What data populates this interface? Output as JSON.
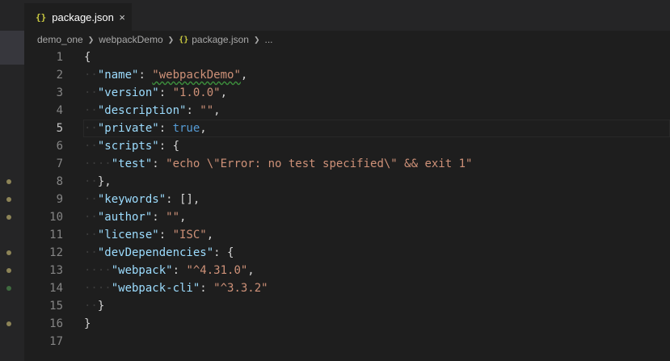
{
  "tab": {
    "icon": "{}",
    "label": "package.json",
    "close": "×"
  },
  "breadcrumbs": [
    "demo_one",
    "webpackDemo",
    "package.json",
    "..."
  ],
  "colors": {
    "modified_dot": "#8d8457",
    "added_dot": "#3f6b3f"
  },
  "lines": [
    {
      "n": "1",
      "indent": "",
      "tokens": [
        {
          "t": "punc",
          "v": "{"
        }
      ]
    },
    {
      "n": "2",
      "indent": "··",
      "tokens": [
        {
          "t": "key",
          "v": "\"name\""
        },
        {
          "t": "punc",
          "v": ": "
        },
        {
          "t": "str",
          "v": "\"webpackDemo\"",
          "sq": true
        },
        {
          "t": "punc",
          "v": ","
        }
      ]
    },
    {
      "n": "3",
      "indent": "··",
      "tokens": [
        {
          "t": "key",
          "v": "\"version\""
        },
        {
          "t": "punc",
          "v": ": "
        },
        {
          "t": "str",
          "v": "\"1.0.0\""
        },
        {
          "t": "punc",
          "v": ","
        }
      ]
    },
    {
      "n": "4",
      "indent": "··",
      "tokens": [
        {
          "t": "key",
          "v": "\"description\""
        },
        {
          "t": "punc",
          "v": ": "
        },
        {
          "t": "str",
          "v": "\"\""
        },
        {
          "t": "punc",
          "v": ","
        }
      ]
    },
    {
      "n": "5",
      "indent": "··",
      "current": true,
      "tokens": [
        {
          "t": "key",
          "v": "\"private\""
        },
        {
          "t": "punc",
          "v": ": "
        },
        {
          "t": "bool",
          "v": "true"
        },
        {
          "t": "punc",
          "v": ","
        }
      ]
    },
    {
      "n": "6",
      "indent": "··",
      "tokens": [
        {
          "t": "key",
          "v": "\"scripts\""
        },
        {
          "t": "punc",
          "v": ": {"
        }
      ]
    },
    {
      "n": "7",
      "indent": "····",
      "tokens": [
        {
          "t": "key",
          "v": "\"test\""
        },
        {
          "t": "punc",
          "v": ": "
        },
        {
          "t": "str",
          "v": "\"echo \\\"Error: no test specified\\\" && exit 1\""
        }
      ]
    },
    {
      "n": "8",
      "indent": "··",
      "dot": "modified",
      "tokens": [
        {
          "t": "punc",
          "v": "},"
        }
      ]
    },
    {
      "n": "9",
      "indent": "··",
      "dot": "modified",
      "tokens": [
        {
          "t": "key",
          "v": "\"keywords\""
        },
        {
          "t": "punc",
          "v": ": [],"
        }
      ]
    },
    {
      "n": "10",
      "indent": "··",
      "dot": "modified",
      "tokens": [
        {
          "t": "key",
          "v": "\"author\""
        },
        {
          "t": "punc",
          "v": ": "
        },
        {
          "t": "str",
          "v": "\"\""
        },
        {
          "t": "punc",
          "v": ","
        }
      ]
    },
    {
      "n": "11",
      "indent": "··",
      "tokens": [
        {
          "t": "key",
          "v": "\"license\""
        },
        {
          "t": "punc",
          "v": ": "
        },
        {
          "t": "str",
          "v": "\"ISC\""
        },
        {
          "t": "punc",
          "v": ","
        }
      ]
    },
    {
      "n": "12",
      "indent": "··",
      "dot": "modified",
      "tokens": [
        {
          "t": "key",
          "v": "\"devDependencies\""
        },
        {
          "t": "punc",
          "v": ": {"
        }
      ]
    },
    {
      "n": "13",
      "indent": "····",
      "dot": "modified",
      "tokens": [
        {
          "t": "key",
          "v": "\"webpack\""
        },
        {
          "t": "punc",
          "v": ": "
        },
        {
          "t": "str",
          "v": "\"^4.31.0\""
        },
        {
          "t": "punc",
          "v": ","
        }
      ]
    },
    {
      "n": "14",
      "indent": "····",
      "dot": "added",
      "tokens": [
        {
          "t": "key",
          "v": "\"webpack-cli\""
        },
        {
          "t": "punc",
          "v": ": "
        },
        {
          "t": "str",
          "v": "\"^3.3.2\""
        }
      ]
    },
    {
      "n": "15",
      "indent": "··",
      "tokens": [
        {
          "t": "punc",
          "v": "}"
        }
      ]
    },
    {
      "n": "16",
      "indent": "",
      "dot": "modified",
      "tokens": [
        {
          "t": "punc",
          "v": "}"
        }
      ]
    },
    {
      "n": "17",
      "indent": "",
      "tokens": []
    }
  ]
}
